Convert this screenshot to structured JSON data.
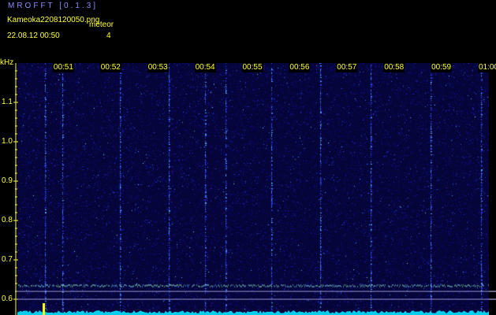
{
  "app": {
    "title": "MROFFT [0.1.3]"
  },
  "file": {
    "name": "Kameoka2208120050.png"
  },
  "meteor": {
    "label": "meteor",
    "count": "4"
  },
  "timestamp": "22.08.12 00:50",
  "y_axis": {
    "unit": "kHz",
    "ticks": [
      {
        "value": 1.1,
        "label": "1.1"
      },
      {
        "value": 1.0,
        "label": "1.0"
      },
      {
        "value": 0.9,
        "label": "0.9"
      },
      {
        "value": 0.8,
        "label": "0.8"
      },
      {
        "value": 0.7,
        "label": "0.7"
      },
      {
        "value": 0.6,
        "label": "0.6"
      }
    ]
  },
  "x_axis": {
    "ticks": [
      {
        "minute": 1,
        "label": "00:51"
      },
      {
        "minute": 2,
        "label": "00:52"
      },
      {
        "minute": 3,
        "label": "00:53"
      },
      {
        "minute": 4,
        "label": "00:54"
      },
      {
        "minute": 5,
        "label": "00:55"
      },
      {
        "minute": 6,
        "label": "00:56"
      },
      {
        "minute": 7,
        "label": "00:57"
      },
      {
        "minute": 8,
        "label": "00:58"
      },
      {
        "minute": 9,
        "label": "00:59"
      },
      {
        "minute": 10,
        "label": "01:00"
      }
    ]
  },
  "colors": {
    "axis_text": "#ffff33",
    "title_text": "#8c8cff",
    "background_noise": "#0a0a6e",
    "signal_line": "#7fd7ff",
    "level_trace": "#00e5ff",
    "meteor_blip": "#ffff00"
  }
}
